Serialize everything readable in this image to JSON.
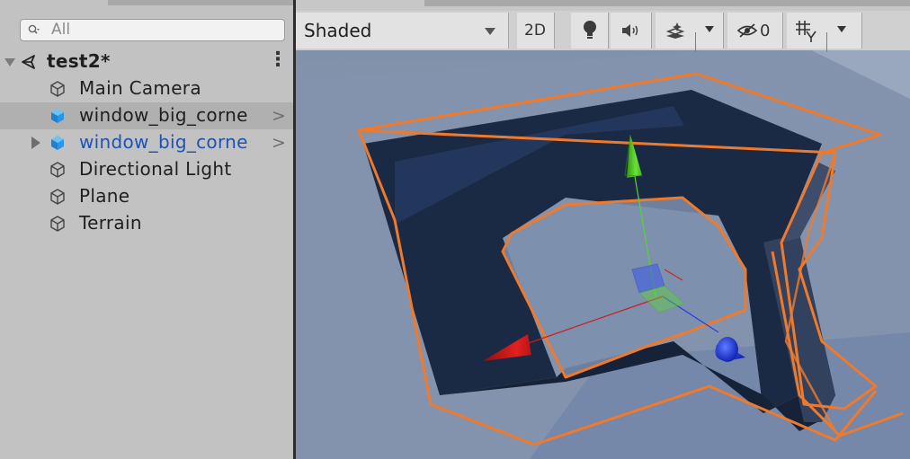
{
  "hierarchy": {
    "search": {
      "placeholder": "All"
    },
    "scene": {
      "name": "test2*",
      "menu_glyph": "⋮"
    },
    "items": [
      {
        "label": "Main Camera",
        "icon": "gameobject-icon",
        "selected": false
      },
      {
        "label": "window_big_corne",
        "icon": "prefab-icon",
        "selected": true,
        "chevron": ">"
      },
      {
        "label": "window_big_corne",
        "icon": "prefab-icon",
        "selected": false,
        "chevron": ">",
        "expandable": true
      },
      {
        "label": "Directional Light",
        "icon": "gameobject-icon",
        "selected": false
      },
      {
        "label": "Plane",
        "icon": "gameobject-icon",
        "selected": false
      },
      {
        "label": "Terrain",
        "icon": "gameobject-icon",
        "selected": false
      }
    ]
  },
  "scene_view": {
    "toolbar": {
      "shading_mode": "Shaded",
      "toggle_2d": "2D",
      "hidden_count": "0"
    },
    "colors": {
      "selection_outline": "#f07a2c",
      "gizmo_x": "#d21818",
      "gizmo_y": "#4ec826",
      "gizmo_z": "#1a3cd8",
      "mesh": "#1b2a42",
      "sky": "#8d9db5"
    }
  }
}
